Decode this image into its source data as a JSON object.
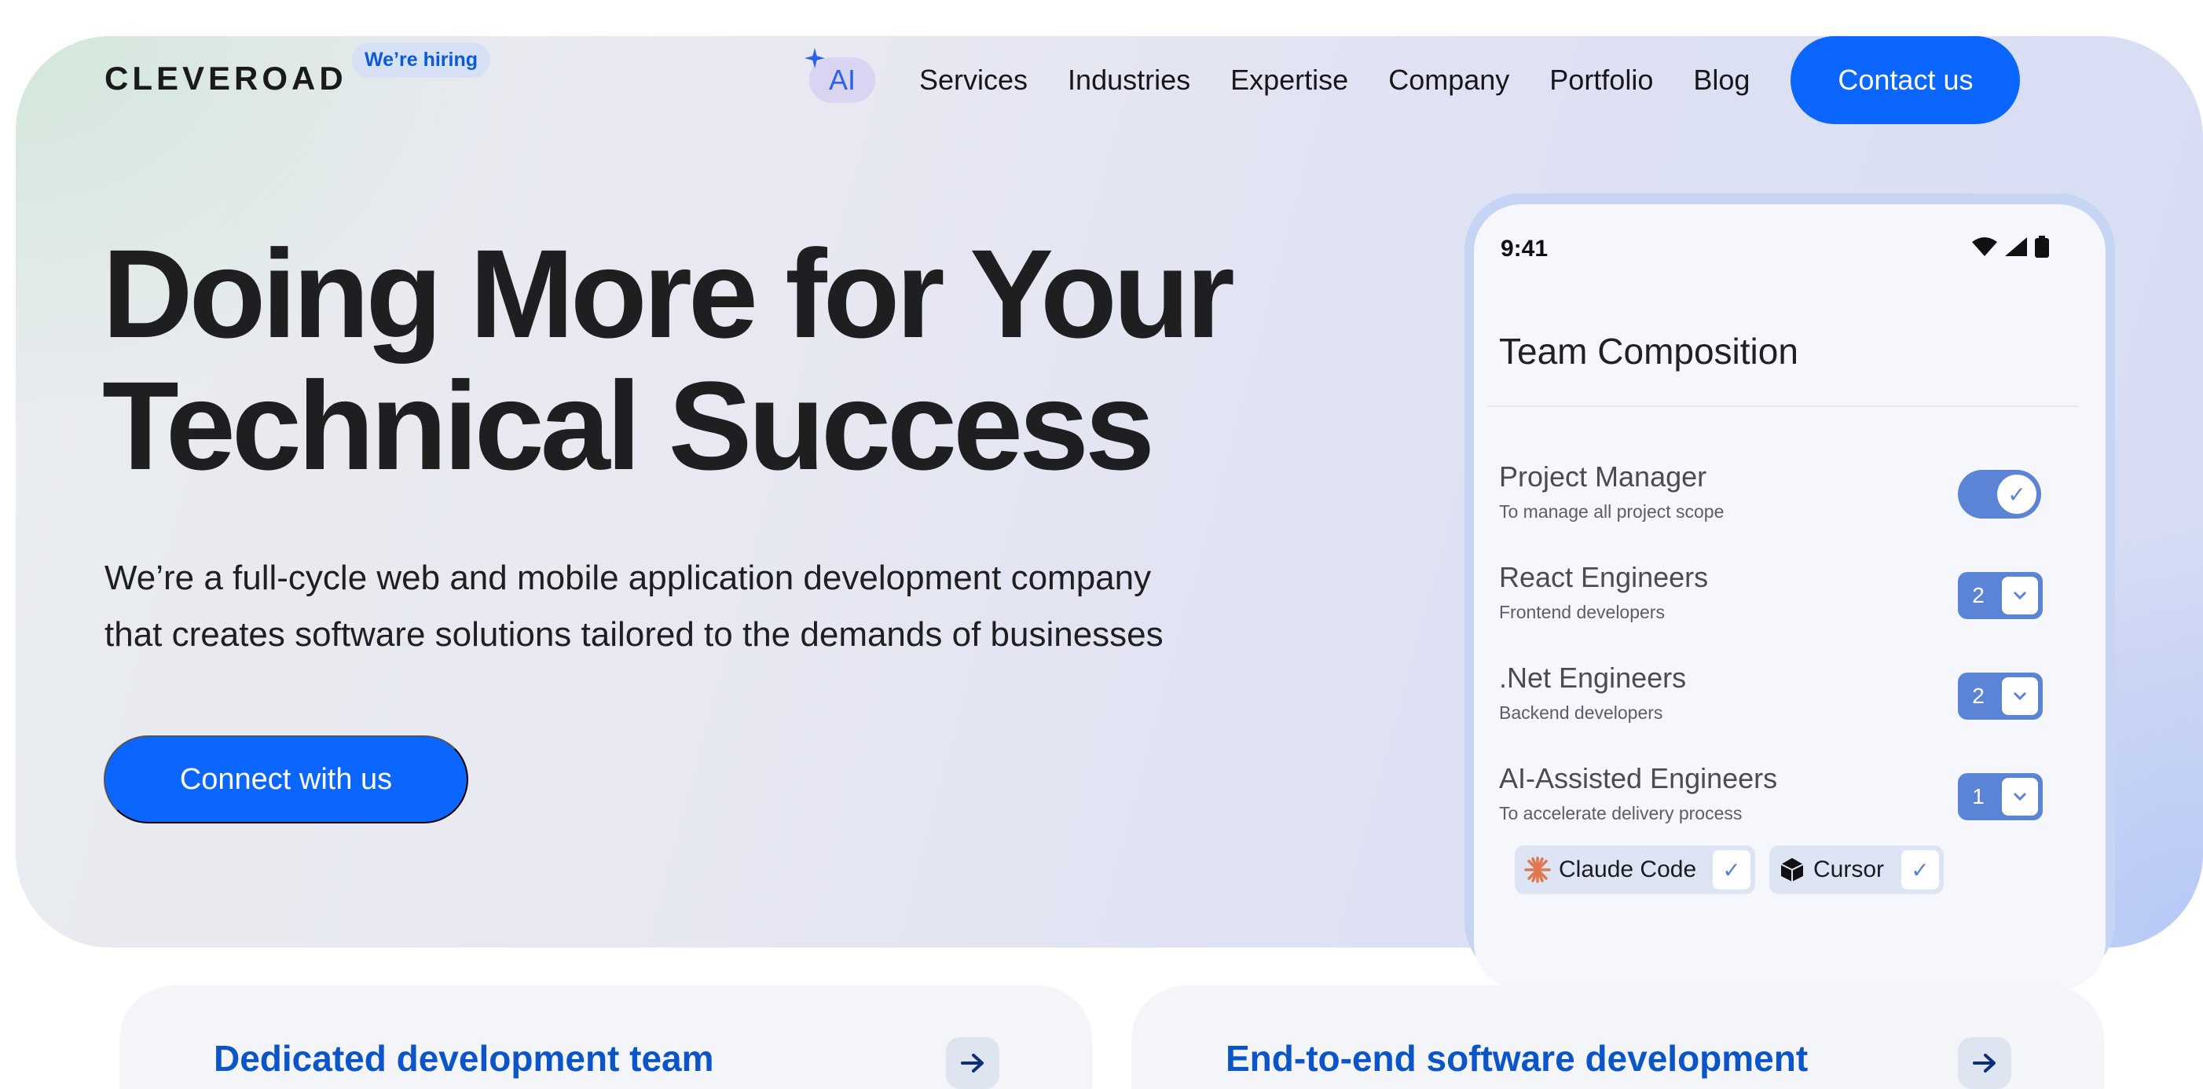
{
  "brand": {
    "logo": "CLEVEROAD",
    "hiring_badge": "We’re hiring"
  },
  "nav": {
    "ai_label": "AI",
    "items": [
      "Services",
      "Industries",
      "Expertise",
      "Company",
      "Portfolio",
      "Blog"
    ],
    "contact_label": "Contact us"
  },
  "hero": {
    "headline_line1": "Doing More for Your",
    "headline_line2": "Technical Success",
    "subtitle_line1": "We’re a full-cycle web and mobile application development company",
    "subtitle_line2": "that creates software solutions tailored to the demands of businesses",
    "cta_label": "Connect with us"
  },
  "phone": {
    "time": "9:41",
    "title": "Team Composition",
    "rows": [
      {
        "title": "Project Manager",
        "desc": "To manage all project scope",
        "control": "toggle",
        "on": true
      },
      {
        "title": "React Engineers",
        "desc": "Frontend developers",
        "control": "stepper",
        "count": "2"
      },
      {
        "title": ".Net Engineers",
        "desc": "Backend developers",
        "control": "stepper",
        "count": "2"
      },
      {
        "title": "AI-Assisted Engineers",
        "desc": "To accelerate delivery process",
        "control": "stepper",
        "count": "1"
      }
    ],
    "tools": [
      {
        "label": "Claude Code",
        "checked": true
      },
      {
        "label": "Cursor",
        "checked": true
      }
    ]
  },
  "cards": [
    {
      "title": "Dedicated development team"
    },
    {
      "title": "End-to-end software development"
    }
  ],
  "colors": {
    "primary": "#0a66ff",
    "control": "#5b83d6",
    "card_title": "#0c55c8"
  }
}
